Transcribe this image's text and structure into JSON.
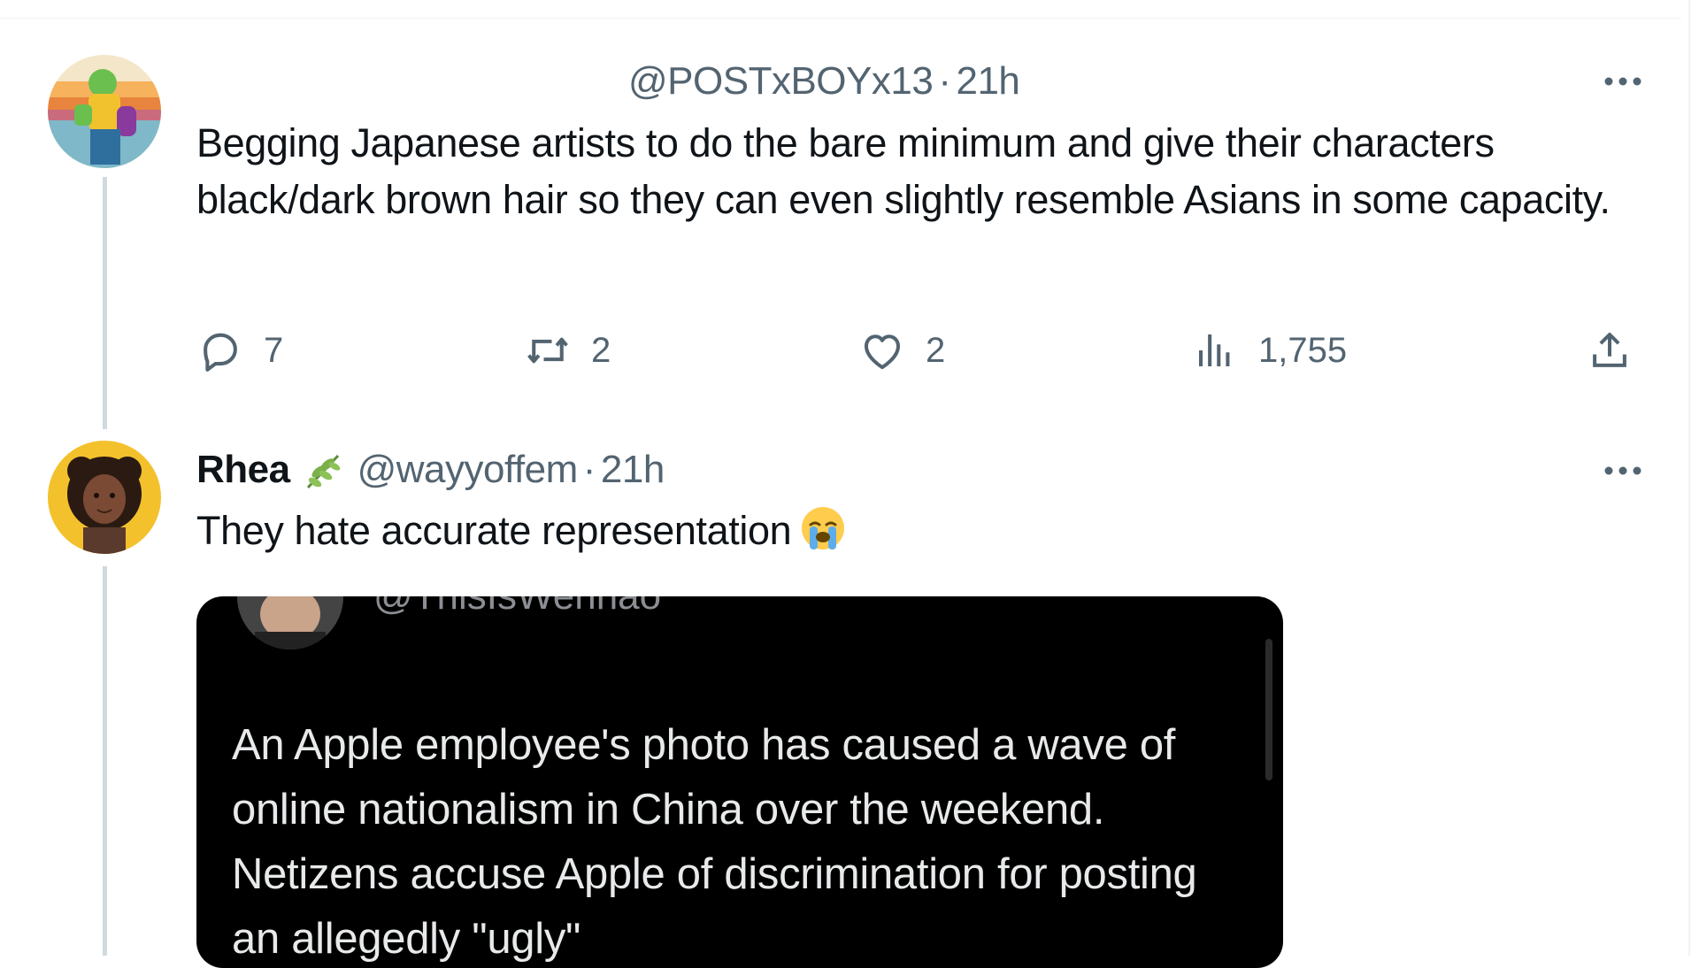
{
  "colors": {
    "text_primary": "#0f1419",
    "text_secondary": "#536471",
    "thread_line": "#cfd9de",
    "quote_bg": "#000000",
    "quote_text": "#e7e9ea"
  },
  "tweet1": {
    "handle": "@POSTxBOYx13",
    "separator": "·",
    "time": "21h",
    "text": "Begging Japanese artists to do the bare minimum and give their characters black/dark brown hair so they can even slightly resemble Asians in some capacity.",
    "more_icon": "more-dots-icon",
    "actions": {
      "replies": "7",
      "retweets": "2",
      "likes": "2",
      "views": "1,755"
    }
  },
  "tweet2": {
    "display_name": "Rhea",
    "badge_icon": "plant-sprig-icon",
    "handle": "@wayyoffem",
    "separator": "·",
    "time": "21h",
    "text": "They hate accurate representation",
    "emoji": "loudly-crying-face-icon",
    "more_icon": "more-dots-icon",
    "quote": {
      "handle": "@ThisIsWenhao",
      "text": "An Apple employee's photo has caused a wave of online nationalism in China over the weekend. Netizens accuse Apple of discrimination for posting an allegedly \"ugly\""
    }
  }
}
